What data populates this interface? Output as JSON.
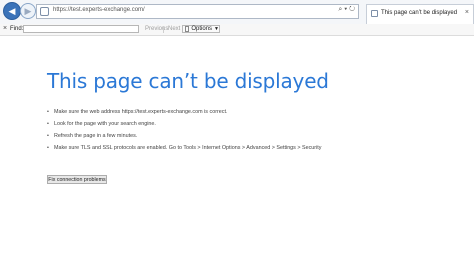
{
  "browser": {
    "address": "https://test.experts-exchange.com/",
    "address_tools": "⌕ ▾ ↻",
    "tab_title": "This page can’t be displayed",
    "tab_close": "×"
  },
  "findbar": {
    "close": "×",
    "label": "Find:",
    "value": "",
    "previous": "Previous",
    "next": "Next",
    "options": "Options"
  },
  "error": {
    "title": "This page can’t be displayed",
    "tips": [
      "Make sure the web address https://test.experts-exchange.com is correct.",
      "Look for the page with your search engine.",
      "Refresh the page in a few minutes.",
      "Make sure TLS and SSL protocols are enabled. Go to Tools > Internet Options > Advanced > Settings > Security"
    ],
    "fix_button": "Fix connection problems"
  },
  "colors": {
    "title": "#2b78d6",
    "back_button": "#3b73b9"
  },
  "icons": {
    "back": "back-arrow-icon",
    "forward": "forward-arrow-icon",
    "page": "page-icon",
    "close": "close-icon",
    "options": "options-icon"
  }
}
